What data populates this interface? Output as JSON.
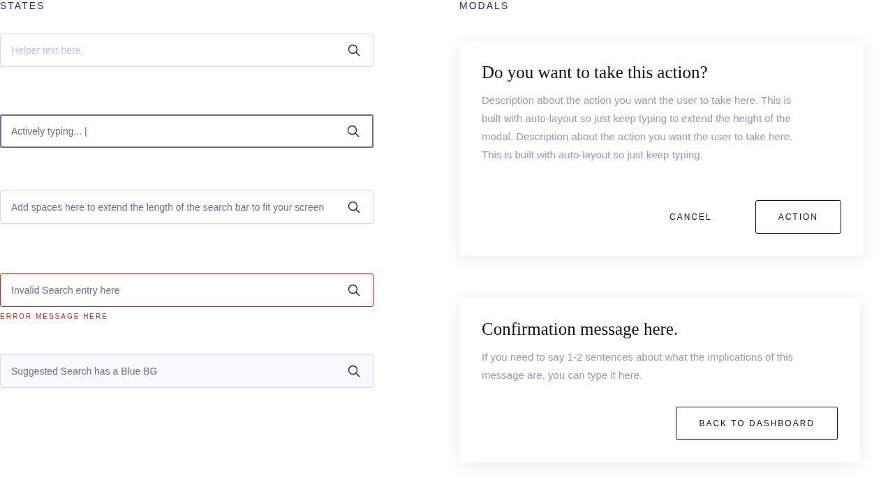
{
  "states": {
    "heading": "STATES",
    "fields": [
      {
        "kind": "empty",
        "placeholder": "Helper text here."
      },
      {
        "kind": "focused",
        "value": "Actively typing... |"
      },
      {
        "kind": "default",
        "value": "Add spaces here to extend the length of the search bar to fit your screen"
      },
      {
        "kind": "error",
        "value": "Invalid Search entry here",
        "error_message": "ERROR MESSAGE HERE"
      },
      {
        "kind": "suggested",
        "value": "Suggested Search has a Blue BG"
      }
    ]
  },
  "modals": {
    "heading": "MODALS",
    "dialogs": [
      {
        "title": "Do you want to take this action?",
        "description": "Description about the action you want the user to take here. This is built with auto-layout so just keep typing to extend the height of the modal. Description about the action you want the user to take here. This is built with auto-layout so just keep typing.",
        "buttons": [
          {
            "label": "CANCEL",
            "kind": "text"
          },
          {
            "label": "ACTION",
            "kind": "outline"
          }
        ]
      },
      {
        "title": "Confirmation message here.",
        "description": "If you need to say 1-2 sentences about what the implications of this message are, you can type it here.",
        "buttons": [
          {
            "label": "BACK TO DASHBOARD",
            "kind": "outline"
          }
        ]
      }
    ]
  }
}
